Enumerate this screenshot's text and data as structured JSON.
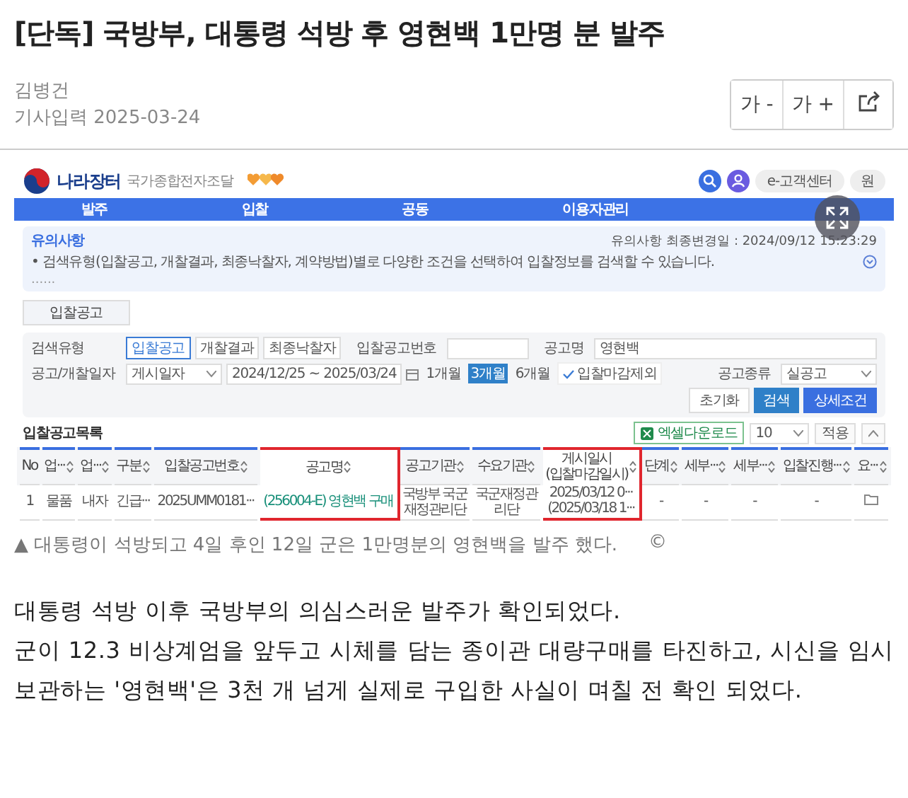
{
  "article": {
    "title": "[단독] 국방부, 대통령 석방 후 영현백 1만명 분 발주",
    "author": "김병건",
    "date_label": "기사입력",
    "date": "2025-03-24",
    "font_buttons": [
      "가 -",
      "가 +"
    ]
  },
  "figure": {
    "site": {
      "logo": "나라장터",
      "logo_sub": "국가종합전자조달",
      "header_buttons": [
        "e-고객센터",
        "원"
      ],
      "nav": [
        "발주",
        "입찰",
        "공동",
        "이용자관리"
      ],
      "notice": {
        "title": "유의사항",
        "updated": "유의사항 최종변경일 : 2024/09/12 15:23:29",
        "text": "• 검색유형(입찰공고, 개찰결과, 최종낙찰자, 계약방법)별로 다양한 조건을 선택하여 입찰정보를 검색할 수 있습니다.",
        "more": "......"
      },
      "tabs": [
        {
          "label": "입찰공고",
          "selected": true
        }
      ],
      "search": {
        "type_label": "검색유형",
        "types": [
          {
            "label": "입찰공고",
            "selected": true
          },
          {
            "label": "개찰결과",
            "selected": false
          },
          {
            "label": "최종낙찰자",
            "selected": false
          }
        ],
        "number_label": "입찰공고번호",
        "name_label": "공고명",
        "name_value": "영현백",
        "date_label": "공고/개찰일자",
        "date_type": "게시일자",
        "date_from": "2024/12/25",
        "date_sep": "~",
        "date_to": "2025/03/24",
        "periods": [
          {
            "label": "1개월",
            "selected": false
          },
          {
            "label": "3개월",
            "selected": true
          },
          {
            "label": "6개월",
            "selected": false
          }
        ],
        "exclude": {
          "label": "입찰마감제외",
          "checked": true
        },
        "kind_label": "공고종류",
        "kind_value": "실공고",
        "buttons": [
          {
            "label": "초기화",
            "kind": "reset"
          },
          {
            "label": "검색",
            "kind": "search"
          },
          {
            "label": "상세조건",
            "kind": "detail"
          }
        ]
      },
      "list": {
        "title": "입찰공고목록",
        "excel": "엑셀다운로드",
        "page_size": "10",
        "apply": "적용",
        "columns": [
          {
            "label": "No",
            "sortable": false,
            "highlighted": false
          },
          {
            "label": "업···",
            "sortable": true,
            "highlighted": false
          },
          {
            "label": "업···",
            "sortable": true,
            "highlighted": false
          },
          {
            "label": "구분",
            "sortable": true,
            "highlighted": false
          },
          {
            "label": "입찰공고번호",
            "sortable": true,
            "highlighted": false
          },
          {
            "label": "공고명",
            "sortable": true,
            "highlighted": true
          },
          {
            "label": "공고기관",
            "sortable": true,
            "highlighted": false
          },
          {
            "label": "수요기관",
            "sortable": true,
            "highlighted": false
          },
          {
            "label": "게시일시",
            "sublabel": "(입찰마감일시)",
            "sortable": true,
            "highlighted": true
          },
          {
            "label": "단계",
            "sortable": true,
            "highlighted": false
          },
          {
            "label": "세부···",
            "sortable": true,
            "highlighted": false
          },
          {
            "label": "세부···",
            "sortable": true,
            "highlighted": false
          },
          {
            "label": "입찰진행···",
            "sortable": true,
            "highlighted": false
          },
          {
            "label": "요···",
            "sortable": true,
            "highlighted": false
          }
        ],
        "rows": [
          {
            "cells": [
              "1",
              "물품",
              "내자",
              "긴급···",
              "2025UMM0181···",
              "(256004-E) 영현백 구매",
              [
                "국방부 국군",
                "재정관리단"
              ],
              [
                "국군재정관",
                "리단"
              ],
              [
                "2025/03/12 0···",
                "(2025/03/18 1···"
              ],
              "-",
              "-",
              "-",
              "-"
            ],
            "attachment": true
          }
        ]
      }
    },
    "caption": "▲ 대통령이 석방되고 4일 후인 12일 군은 1만명분의 영현백을 발주 했다.",
    "caption_mark": "©"
  },
  "body": [
    "대통령 석방 이후 국방부의 의심스러운 발주가 확인되었다.",
    "군이 12.3 비상계엄을 앞두고 시체를 담는 종이관 대량구매를 타진하고, 시신을 임시 보관하는 '영현백'은 3천 개 넘게 실제로 구입한 사실이 며칠 전 확인 되었다."
  ]
}
